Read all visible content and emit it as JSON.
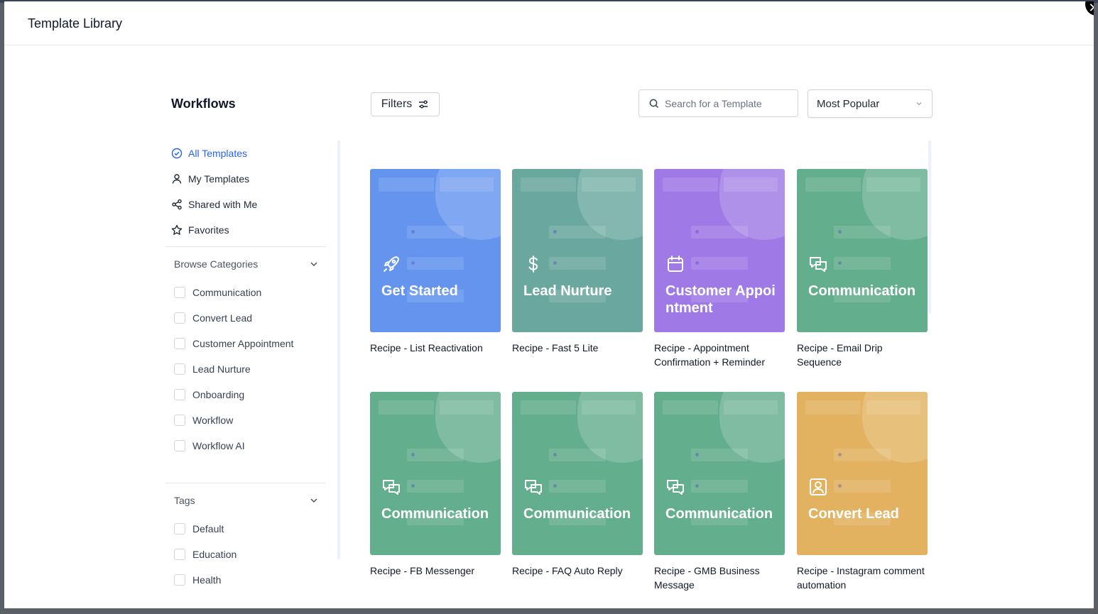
{
  "modal": {
    "title": "Template Library",
    "close_glyph": "✕"
  },
  "sidebar": {
    "heading": "Workflows",
    "nav": [
      {
        "label": "All Templates",
        "icon": "check-circle-icon",
        "active": true
      },
      {
        "label": "My Templates",
        "icon": "user-icon",
        "active": false
      },
      {
        "label": "Shared with Me",
        "icon": "share-icon",
        "active": false
      },
      {
        "label": "Favorites",
        "icon": "star-icon",
        "active": false
      }
    ],
    "categories": {
      "label": "Browse Categories",
      "items": [
        "Communication",
        "Convert Lead",
        "Customer Appointment",
        "Lead Nurture",
        "Onboarding",
        "Workflow",
        "Workflow AI"
      ]
    },
    "tags": {
      "label": "Tags",
      "items": [
        "Default",
        "Education",
        "Health"
      ]
    }
  },
  "toolbar": {
    "filters_label": "Filters",
    "search_placeholder": "Search for a Template",
    "sort_value": "Most Popular"
  },
  "colors": {
    "blue": "#6494ee",
    "teal": "#6aa89f",
    "purple": "#9f79e6",
    "green": "#63ae8d",
    "orange": "#e2b260",
    "active_link": "#2563eb"
  },
  "templates": [
    {
      "thumb_title": "Get Started",
      "caption": "Recipe - List Reactivation",
      "icon": "rocket-icon",
      "color": "#6494ee"
    },
    {
      "thumb_title": "Lead Nurture",
      "caption": "Recipe - Fast 5 Lite",
      "icon": "dollar-icon",
      "color": "#6aa89f"
    },
    {
      "thumb_title": "Customer Appointment",
      "caption": "Recipe - Appointment Confirmation + Reminder",
      "icon": "calendar-icon",
      "color": "#9f79e6"
    },
    {
      "thumb_title": "Communication",
      "caption": "Recipe - Email Drip Sequence",
      "icon": "chat-icon",
      "color": "#63ae8d"
    },
    {
      "thumb_title": "Communication",
      "caption": "Recipe - FB Messenger",
      "icon": "chat-icon",
      "color": "#63ae8d"
    },
    {
      "thumb_title": "Communication",
      "caption": "Recipe - FAQ Auto Reply",
      "icon": "chat-icon",
      "color": "#63ae8d"
    },
    {
      "thumb_title": "Communication",
      "caption": "Recipe - GMB Business Message",
      "icon": "chat-icon",
      "color": "#63ae8d"
    },
    {
      "thumb_title": "Convert Lead",
      "caption": "Recipe - Instagram comment automation",
      "icon": "contact-icon",
      "color": "#e2b260"
    }
  ]
}
